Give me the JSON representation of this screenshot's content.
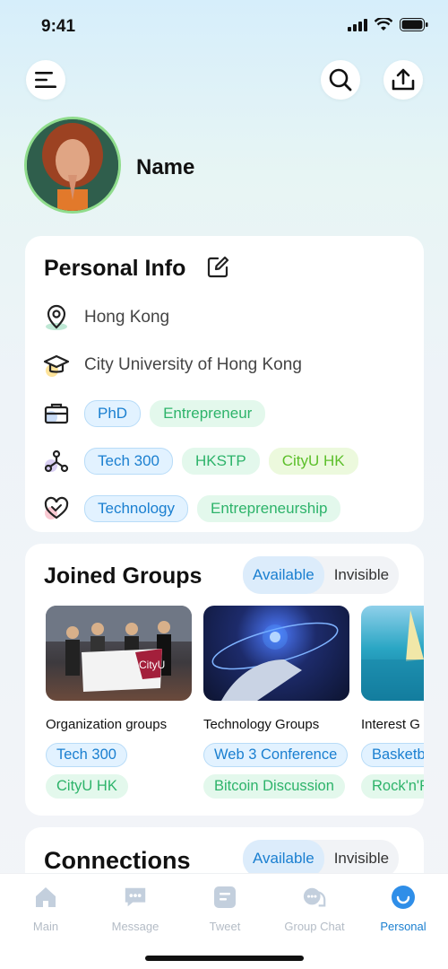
{
  "status_bar": {
    "time": "9:41"
  },
  "profile": {
    "name": "Name"
  },
  "personal_info": {
    "title": "Personal Info",
    "location": "Hong Kong",
    "school": "City University of Hong Kong",
    "roles": [
      "PhD",
      "Entrepreneur"
    ],
    "networks": [
      "Tech 300",
      "HKSTP",
      "CityU HK"
    ],
    "interests": [
      "Technology",
      "Entrepreneurship"
    ]
  },
  "joined_groups": {
    "title": "Joined Groups",
    "toggle": {
      "available": "Available",
      "invisible": "Invisible"
    },
    "groups": [
      {
        "name": "Organization groups",
        "tags": [
          "Tech 300",
          "CityU HK"
        ],
        "banner_text": "CityU"
      },
      {
        "name": "Technology Groups",
        "tags": [
          "Web 3 Conference",
          "Bitcoin Discussion"
        ]
      },
      {
        "name": "Interest G",
        "tags": [
          "Basketb",
          "Rock'n'R"
        ]
      }
    ]
  },
  "connections": {
    "title": "Connections",
    "toggle": {
      "available": "Available",
      "invisible": "Invisible"
    }
  },
  "tabbar": {
    "tabs": [
      {
        "label": "Main",
        "icon": "home-icon"
      },
      {
        "label": "Message",
        "icon": "message-icon"
      },
      {
        "label": "Tweet",
        "icon": "tweet-icon"
      },
      {
        "label": "Group Chat",
        "icon": "group-chat-icon"
      },
      {
        "label": "Personal",
        "icon": "personal-icon",
        "active": true
      }
    ]
  },
  "colors": {
    "accent": "#1a7fd0",
    "green_tag": "#2db36a",
    "avatar_ring": "#8fdc8c"
  }
}
